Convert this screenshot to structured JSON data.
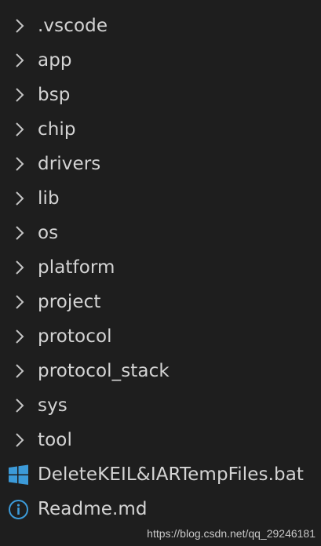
{
  "explorer": {
    "folders": [
      {
        "name": ".vscode",
        "icon": "chevron-right-icon"
      },
      {
        "name": "app",
        "icon": "chevron-right-icon"
      },
      {
        "name": "bsp",
        "icon": "chevron-right-icon"
      },
      {
        "name": "chip",
        "icon": "chevron-right-icon"
      },
      {
        "name": "drivers",
        "icon": "chevron-right-icon"
      },
      {
        "name": "lib",
        "icon": "chevron-right-icon"
      },
      {
        "name": "os",
        "icon": "chevron-right-icon"
      },
      {
        "name": "platform",
        "icon": "chevron-right-icon"
      },
      {
        "name": "project",
        "icon": "chevron-right-icon"
      },
      {
        "name": "protocol",
        "icon": "chevron-right-icon"
      },
      {
        "name": "protocol_stack",
        "icon": "chevron-right-icon"
      },
      {
        "name": "sys",
        "icon": "chevron-right-icon"
      },
      {
        "name": "tool",
        "icon": "chevron-right-icon"
      }
    ],
    "files": [
      {
        "name": "DeleteKEIL&IARTempFiles.bat",
        "icon": "windows-batch-icon",
        "color": "#3c9ad8"
      },
      {
        "name": "Readme.md",
        "icon": "info-icon",
        "color": "#3c9ad8"
      }
    ]
  },
  "watermark": "https://blog.csdn.net/qq_29246181",
  "colors": {
    "background": "#1e1e1e",
    "text": "#d4d4d4",
    "chevron": "#c5c5c5"
  }
}
